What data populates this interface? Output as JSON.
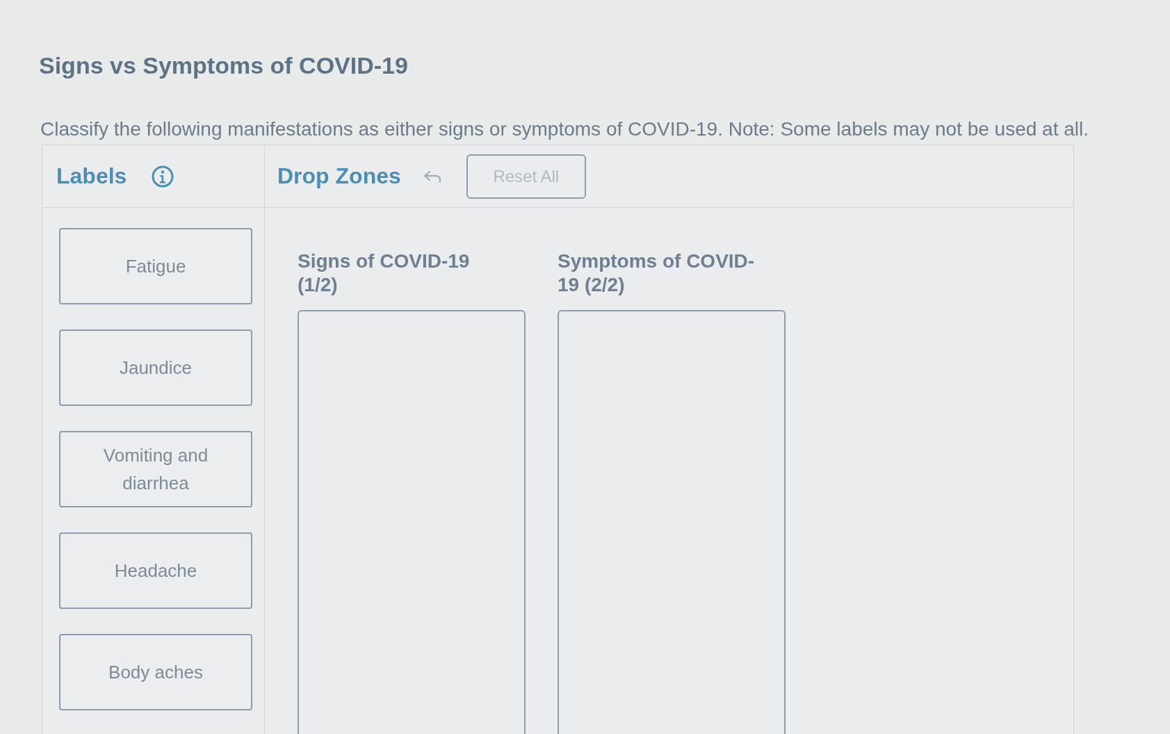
{
  "title": "Signs vs Symptoms of COVID-19",
  "instructions": "Classify the following manifestations as either signs or symptoms of COVID-19. Note: Some labels may not be used at all.",
  "labels_panel": {
    "heading": "Labels",
    "items": [
      "Fatigue",
      "Jaundice",
      "Vomiting and diarrhea",
      "Headache",
      "Body aches"
    ]
  },
  "drop_zones_panel": {
    "heading": "Drop Zones",
    "reset_button": {
      "label": "Reset All",
      "disabled": true
    },
    "zones": [
      {
        "heading": "Signs of COVID-19 (1/2)"
      },
      {
        "heading": "Symptoms of COVID-19 (2/2)"
      }
    ]
  }
}
